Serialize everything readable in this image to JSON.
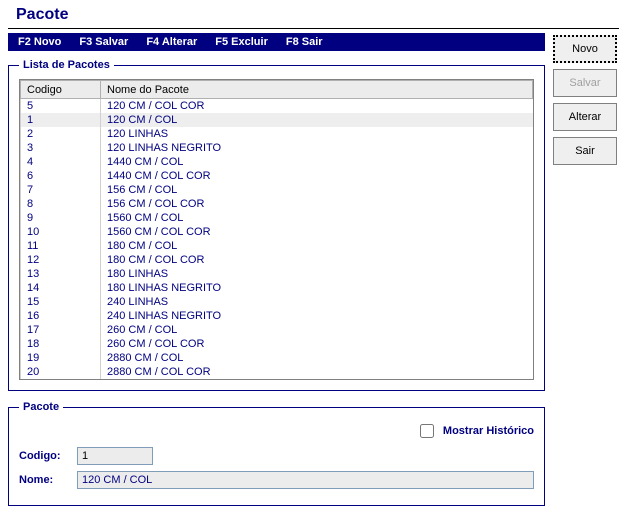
{
  "title": "Pacote",
  "fkeys": [
    "F2 Novo",
    "F3 Salvar",
    "F4 Alterar",
    "F5 Excluir",
    "F8 Sair"
  ],
  "list": {
    "legend": "Lista de Pacotes",
    "columns": {
      "codigo": "Codigo",
      "nome": "Nome do Pacote"
    },
    "rows": [
      {
        "codigo": "5",
        "nome": "120 CM / COL COR"
      },
      {
        "codigo": "1",
        "nome": "120 CM / COL",
        "selected": true
      },
      {
        "codigo": "2",
        "nome": "120 LINHAS"
      },
      {
        "codigo": "3",
        "nome": "120 LINHAS NEGRITO"
      },
      {
        "codigo": "4",
        "nome": "1440 CM / COL"
      },
      {
        "codigo": "6",
        "nome": "1440 CM / COL COR"
      },
      {
        "codigo": "7",
        "nome": "156 CM / COL"
      },
      {
        "codigo": "8",
        "nome": "156 CM / COL COR"
      },
      {
        "codigo": "9",
        "nome": "1560 CM / COL"
      },
      {
        "codigo": "10",
        "nome": "1560 CM / COL COR"
      },
      {
        "codigo": "11",
        "nome": "180 CM / COL"
      },
      {
        "codigo": "12",
        "nome": "180 CM / COL COR"
      },
      {
        "codigo": "13",
        "nome": "180 LINHAS"
      },
      {
        "codigo": "14",
        "nome": "180 LINHAS NEGRITO"
      },
      {
        "codigo": "15",
        "nome": "240 LINHAS"
      },
      {
        "codigo": "16",
        "nome": "240 LINHAS NEGRITO"
      },
      {
        "codigo": "17",
        "nome": "260 CM / COL"
      },
      {
        "codigo": "18",
        "nome": "260 CM / COL COR"
      },
      {
        "codigo": "19",
        "nome": "2880 CM / COL"
      },
      {
        "codigo": "20",
        "nome": "2880 CM / COL COR"
      }
    ]
  },
  "detail": {
    "legend": "Pacote",
    "historico_label": "Mostrar Histórico",
    "historico_checked": false,
    "codigo_label": "Codigo:",
    "codigo_value": "1",
    "nome_label": "Nome:",
    "nome_value": "120 CM / COL"
  },
  "buttons": {
    "novo": "Novo",
    "salvar": "Salvar",
    "alterar": "Alterar",
    "sair": "Sair"
  }
}
